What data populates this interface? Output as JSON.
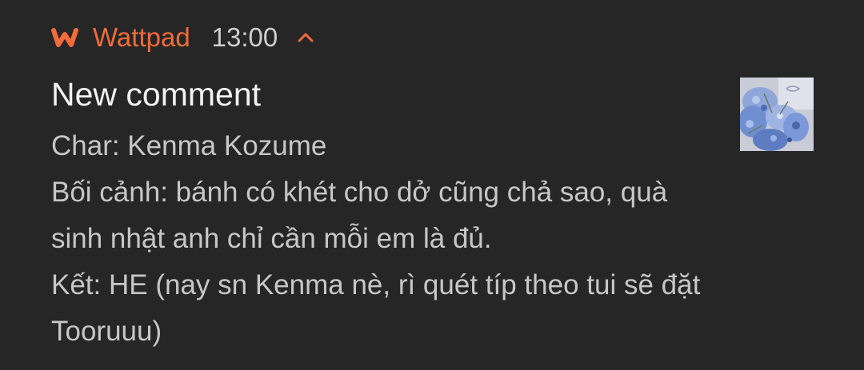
{
  "header": {
    "app_name": "Wattpad",
    "time": "13:00",
    "app_icon": "wattpad-logo-icon",
    "expand_icon": "chevron-up-icon"
  },
  "notification": {
    "title": "New comment",
    "lines": [
      "Char: Kenma Kozume",
      "Bối cảnh: bánh có khét cho dở cũng chả sao, quà",
      "sinh nhật anh chỉ cần mỗi em là đủ.",
      "Kết: HE (nay sn Kenma nè, rì quét típ theo tui sẽ đặt",
      "Tooruuu)"
    ],
    "thumbnail": "blue-flowers-image"
  },
  "colors": {
    "background": "#262626",
    "accent": "#f26b3a",
    "title": "#f2f2f2",
    "text": "#c7c7c7"
  }
}
